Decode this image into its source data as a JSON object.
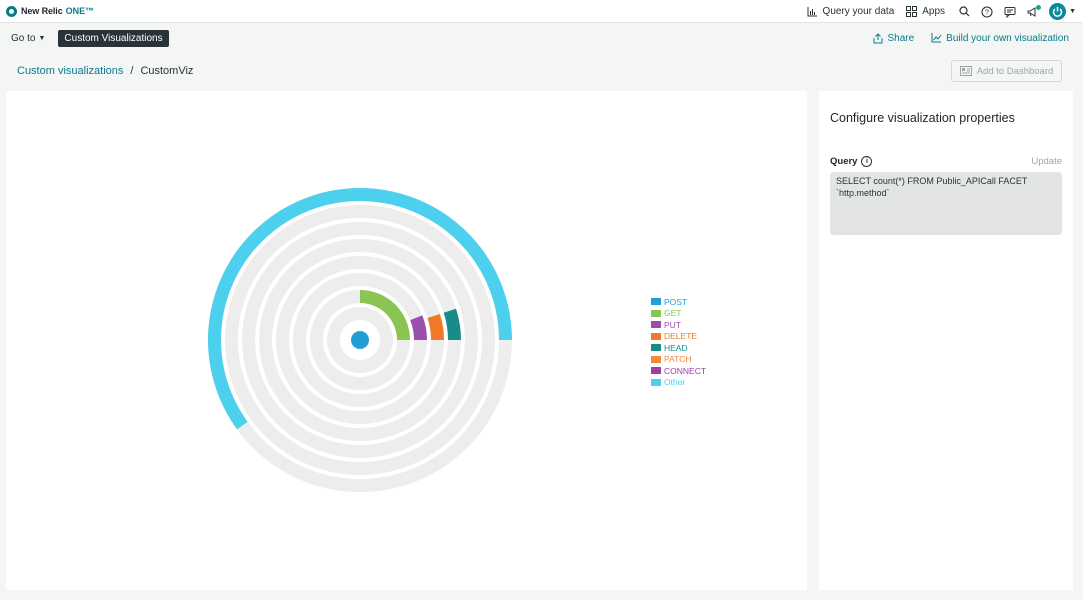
{
  "brand": {
    "name": "New Relic",
    "product": "ONE™"
  },
  "topnav": {
    "query_label": "Query your data",
    "apps_label": "Apps",
    "colors": {
      "accent": "#0a7a8a",
      "notification": "#11a893"
    }
  },
  "subbar": {
    "goto_label": "Go to",
    "chip_label": "Custom Visualizations",
    "share_label": "Share",
    "build_label": "Build your own visualization"
  },
  "breadcrumb": {
    "parent": "Custom visualizations",
    "separator": "/",
    "current": "CustomViz"
  },
  "actions": {
    "add_to_dashboard": "Add to Dashboard"
  },
  "config": {
    "title": "Configure visualization properties",
    "query_label": "Query",
    "update_label": "Update",
    "query_value": "SELECT count(*) FROM Public_APICall FACET\n`http.method`"
  },
  "chart_data": {
    "type": "radial-bar",
    "series": [
      {
        "name": "POST",
        "color": "#1f9ed8",
        "value": 0
      },
      {
        "name": "GET",
        "color": "#8ac453",
        "value": 0.25
      },
      {
        "name": "PUT",
        "color": "#9b4fac",
        "value": 0.06
      },
      {
        "name": "DELETE",
        "color": "#f07a2a",
        "value": 0.05
      },
      {
        "name": "HEAD",
        "color": "#178c8a",
        "value": 0.05
      },
      {
        "name": "PATCH",
        "color": "#f5893b",
        "value": 0
      },
      {
        "name": "CONNECT",
        "color": "#9b3fa8",
        "value": 0
      },
      {
        "name": "Other",
        "color": "#4cd0ee",
        "value": 0.6
      }
    ],
    "track_color": "#ededed"
  }
}
